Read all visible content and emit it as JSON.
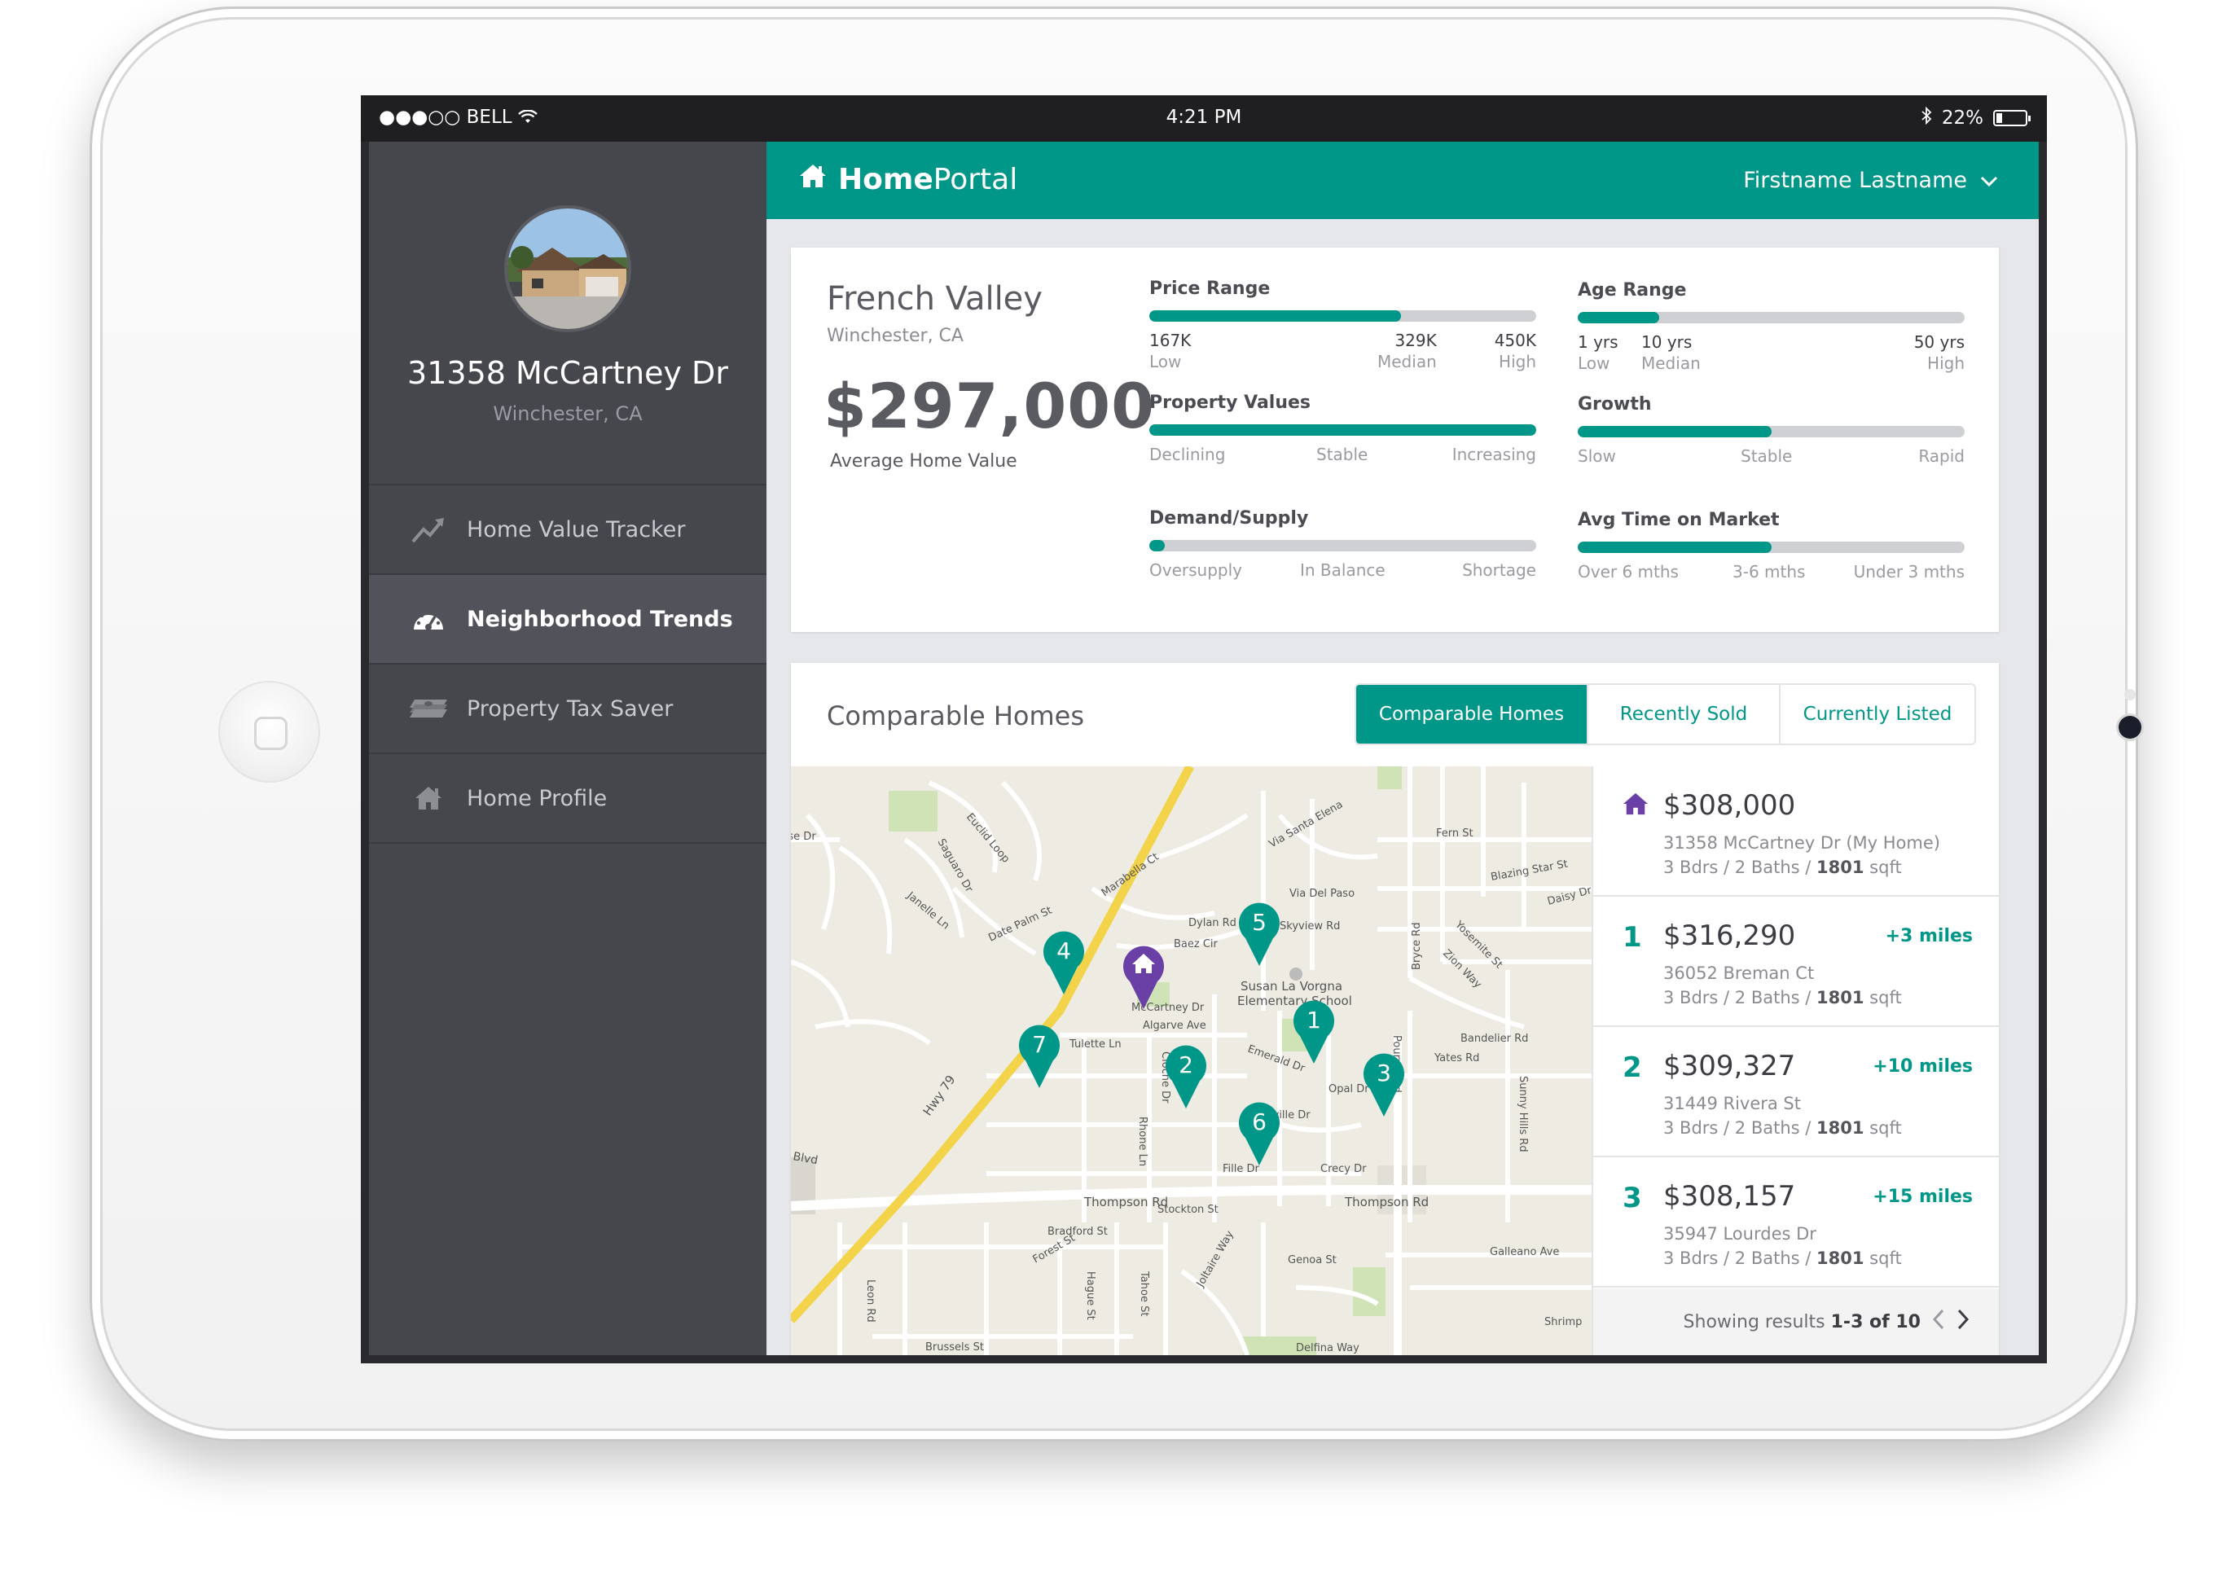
{
  "status": {
    "carrier": "●●●○○ BELL",
    "time": "4:21 PM",
    "battery": "22%",
    "battery_level": 0.22
  },
  "sidebar": {
    "address": "31358 McCartney Dr",
    "city": "Winchester, CA",
    "items": [
      {
        "label": "Home Value Tracker",
        "icon": "trend-icon"
      },
      {
        "label": "Neighborhood Trends",
        "icon": "dashboard-gauge-icon",
        "active": true
      },
      {
        "label": "Property Tax Saver",
        "icon": "money-stack-icon"
      },
      {
        "label": "Home Profile",
        "icon": "house-icon"
      }
    ]
  },
  "header": {
    "brand_bold": "Home",
    "brand_light": "Portal",
    "user": "Firstname Lastname"
  },
  "neighborhood": {
    "name": "French Valley",
    "city": "Winchester, CA",
    "avg_value": "$297,000",
    "avg_label": "Average Home Value"
  },
  "metrics": {
    "price_range": {
      "title": "Price Range",
      "fill": 0.65,
      "low_v": "167K",
      "low_l": "Low",
      "median_v": "329K",
      "median_l": "Median",
      "high_v": "450K",
      "high_l": "High"
    },
    "age_range": {
      "title": "Age Range",
      "fill": 0.21,
      "low_v": "1 yrs",
      "low_l": "Low",
      "median_v": "10 yrs",
      "median_l": "Median",
      "high_v": "50 yrs",
      "high_l": "High"
    },
    "property_values": {
      "title": "Property Values",
      "fill": 1.0,
      "a": "Declining",
      "b": "Stable",
      "c": "Increasing"
    },
    "growth": {
      "title": "Growth",
      "fill": 0.5,
      "a": "Slow",
      "b": "Stable",
      "c": "Rapid"
    },
    "demand_supply": {
      "title": "Demand/Supply",
      "fill": 0.04,
      "a": "Oversupply",
      "b": "In Balance",
      "c": "Shortage"
    },
    "avg_time": {
      "title": "Avg Time on Market",
      "fill": 0.5,
      "a": "Over 6 mths",
      "b": "3-6 mths",
      "c": "Under 3 mths"
    }
  },
  "comparables": {
    "title": "Comparable Homes",
    "tabs": [
      "Comparable Homes",
      "Recently Sold",
      "Currently Listed"
    ],
    "my_home": {
      "price": "$308,000",
      "street": "31358 McCartney Dr (My Home)",
      "beds": "3 Bdrs",
      "baths": "2 Baths",
      "sqft": "1801",
      "sqft_unit": "sqft"
    },
    "items": [
      {
        "num": "1",
        "price": "$316,290",
        "dist": "+3 miles",
        "street": "36052 Breman Ct",
        "beds": "3 Bdrs",
        "baths": "2 Baths",
        "sqft": "1801",
        "sqft_unit": "sqft"
      },
      {
        "num": "2",
        "price": "$309,327",
        "dist": "+10 miles",
        "street": "31449 Rivera St",
        "beds": "3 Bdrs",
        "baths": "2 Baths",
        "sqft": "1801",
        "sqft_unit": "sqft"
      },
      {
        "num": "3",
        "price": "$308,157",
        "dist": "+15 miles",
        "street": "35947 Lourdes Dr",
        "beds": "3 Bdrs",
        "baths": "2 Baths",
        "sqft": "1801",
        "sqft_unit": "sqft"
      }
    ],
    "pager": {
      "prefix": "Showing results",
      "range": "1-3 of 10"
    }
  },
  "map": {
    "pins": [
      "1",
      "2",
      "3",
      "4",
      "5",
      "6",
      "7"
    ],
    "labels": [
      "Thompson Rd",
      "Thompson Rd",
      "Hwy 79",
      "Susan La Vorgna",
      "Elementary School",
      "McCartney Dr",
      "Algarve Ave",
      "Tulette Ln",
      "Granville Dr",
      "Dylan Rd",
      "Baez Cir",
      "Skyview Rd",
      "Via Del Paso",
      "Via Santa Elena",
      "Marabella Ct",
      "Date Palm St",
      "Euclid Loop",
      "Saguaro Dr",
      "Janelle Ln",
      "Fern St",
      "Blazing Star St",
      "Daisy Dr",
      "Yosemite St",
      "Zion Way",
      "Bandelier Rd",
      "Yates Rd",
      "Stockton St",
      "Bradford St",
      "Forest St",
      "Genoa St",
      "Galleano Ave",
      "Fille Dr",
      "Crecy Dr",
      "Opal Dr",
      "Emerald Dr",
      "Brussels St",
      "Shrimp",
      "Blvd",
      "Rose Dr",
      "Pourroy Rd",
      "Rhone Ln",
      "Cloche Dr",
      "Hague St",
      "Tahoe St",
      "Leon Rd",
      "Joltaire Way",
      "Sunny Hills Rd",
      "Bryce Rd",
      "Delfina Way"
    ]
  }
}
